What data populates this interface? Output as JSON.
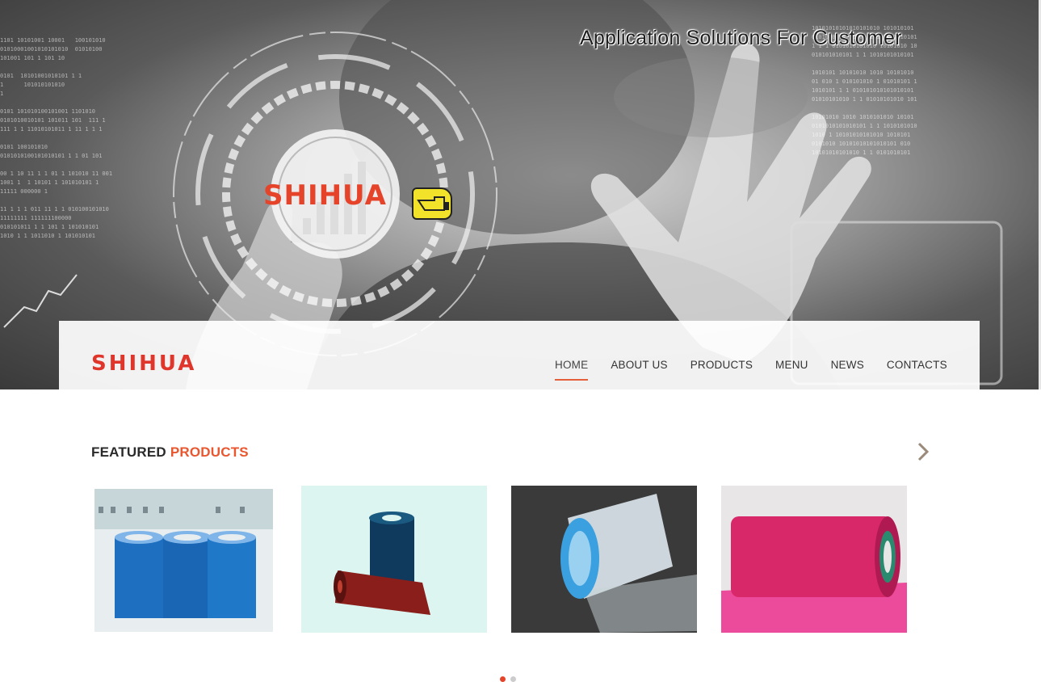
{
  "hero": {
    "title": "Application Solutions For Customer",
    "logo_text": "SHIHUA"
  },
  "nav": {
    "logo_text": "SHIHUA",
    "links": [
      "HOME",
      "ABOUT US",
      "PRODUCTS",
      "MENU",
      "NEWS",
      "CONTACTS"
    ],
    "active": "HOME",
    "accent_color": "#e5603a"
  },
  "featured": {
    "title_part1": "FEATURED",
    "title_part2": "PRODUCTS",
    "next_icon": "chevron-right-icon",
    "products": [
      {
        "name": "blue-film-rolls",
        "color": "#1f78c8"
      },
      {
        "name": "dark-blue-and-red-rolls",
        "color": "#8a1e1a"
      },
      {
        "name": "clear-film-roll",
        "color": "#d8e6f0"
      },
      {
        "name": "pink-film-roll",
        "color": "#e0306a"
      }
    ]
  },
  "carousel": {
    "pages": 2,
    "current": 1
  }
}
